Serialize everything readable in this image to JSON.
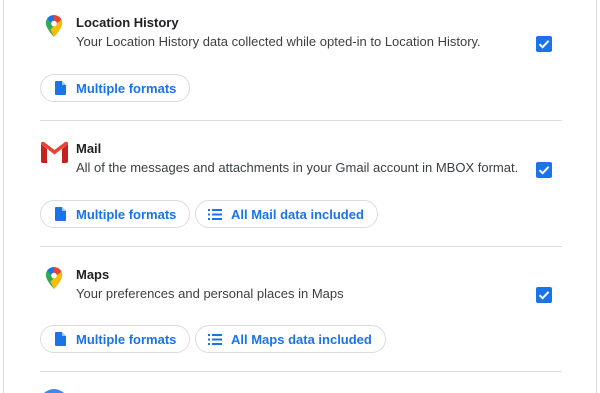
{
  "products": [
    {
      "name": "Location History",
      "description": "Your Location History data collected while opted-in to Location History.",
      "icon": "google-maps-pin-icon",
      "checked": true,
      "chips": [
        {
          "label": "Multiple formats",
          "icon": "document-icon"
        }
      ]
    },
    {
      "name": "Mail",
      "description": "All of the messages and attachments in your Gmail account in MBOX format.",
      "icon": "gmail-icon",
      "checked": true,
      "chips": [
        {
          "label": "Multiple formats",
          "icon": "document-icon"
        },
        {
          "label": "All Mail data included",
          "icon": "list-icon"
        }
      ]
    },
    {
      "name": "Maps",
      "description": "Your preferences and personal places in Maps",
      "icon": "google-maps-pin-icon",
      "checked": true,
      "chips": [
        {
          "label": "Multiple formats",
          "icon": "document-icon"
        },
        {
          "label": "All Maps data included",
          "icon": "list-icon"
        }
      ]
    }
  ],
  "colors": {
    "accent": "#1a73e8",
    "divider": "#dadce0",
    "text": "#202124",
    "secondary_text": "#3c4043"
  }
}
